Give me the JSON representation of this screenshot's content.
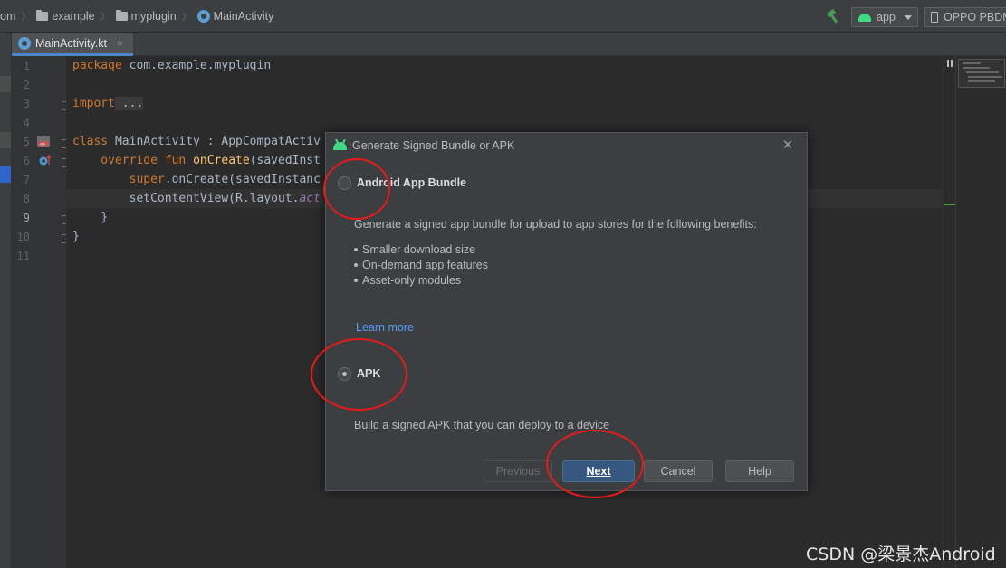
{
  "breadcrumbs": [
    {
      "label": "om",
      "icon": "none"
    },
    {
      "label": "example",
      "icon": "folder-icon"
    },
    {
      "label": "myplugin",
      "icon": "folder-icon"
    },
    {
      "label": "MainActivity",
      "icon": "kotlin-class-icon"
    }
  ],
  "toolbar": {
    "run_config": "app",
    "device": "OPPO PBDM"
  },
  "editor_tab": {
    "title": "MainActivity.kt",
    "close": "×"
  },
  "line_numbers": [
    "1",
    "2",
    "3",
    "4",
    "5",
    "6",
    "7",
    "8",
    "9",
    "10",
    "11"
  ],
  "code": {
    "l1_kw": "package",
    "l1_rest": " com.example.myplugin",
    "l3_kw": "import",
    "l3_rest": " ...",
    "l6_kw": "class",
    "l6_rest": " MainActivity : AppCompatActiv",
    "l7_kw": "    override fun ",
    "l7_fn": "onCreate",
    "l7_rest": "(savedInst",
    "l8_kw": "        super",
    "l8_rest": ".onCreate(savedInstanc",
    "l9_rest": "        setContentView(R.layout.",
    "l9_it": "act",
    "l10": "    }",
    "l11": "}"
  },
  "dialog": {
    "title": "Generate Signed Bundle or APK",
    "close": "✕",
    "option_bundle_label": "Android App Bundle",
    "bundle_description": "Generate a signed app bundle for upload to app stores for the following benefits:",
    "bundle_benefits": [
      "Smaller download size",
      "On-demand app features",
      "Asset-only modules"
    ],
    "learn_more": "Learn more",
    "option_apk_label": "APK",
    "apk_description": "Build a signed APK that you can deploy to a device",
    "selected_option": "APK",
    "buttons": {
      "previous": "Previous",
      "next": "Next",
      "cancel": "Cancel",
      "help": "Help"
    }
  },
  "watermark": "CSDN @梁景杰Android",
  "colors": {
    "editor_bg": "#2b2b2b",
    "dialog_bg": "#3c3f41",
    "keyword": "#cc7832",
    "function": "#ffc66d",
    "link": "#589df6",
    "default_button": "#365880",
    "annotation_red": "#e8191b",
    "android_green": "#3ddc84"
  }
}
